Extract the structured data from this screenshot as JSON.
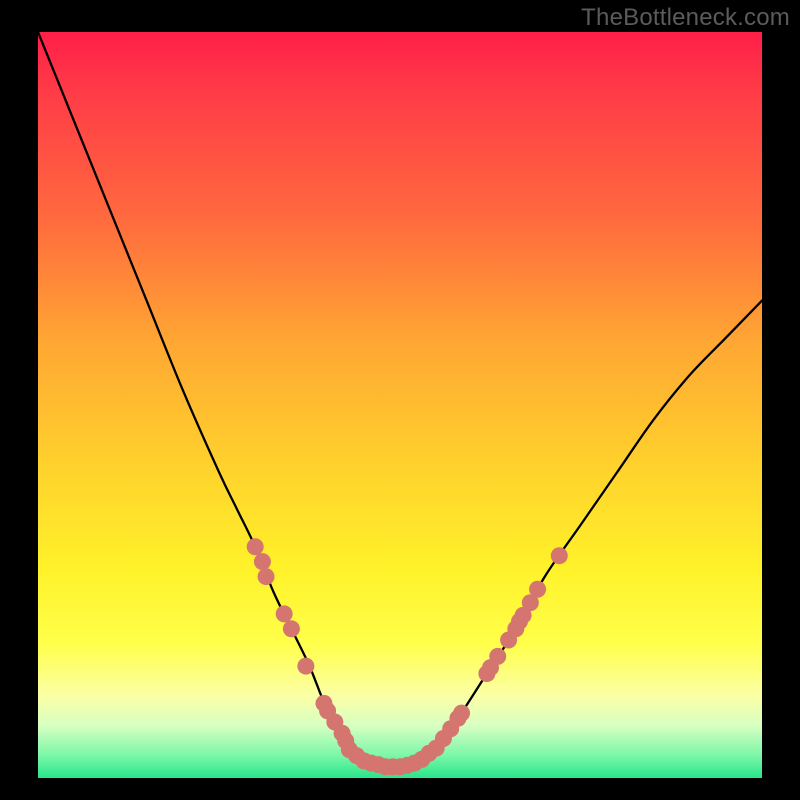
{
  "attribution": "TheBottleneck.com",
  "colors": {
    "frame": "#000000",
    "curve": "#000000",
    "marker_fill": "#d4766f",
    "marker_stroke": "none"
  },
  "chart_data": {
    "type": "line",
    "title": "",
    "xlabel": "",
    "ylabel": "",
    "xlim": [
      0,
      100
    ],
    "ylim": [
      0,
      100
    ],
    "grid": false,
    "legend": false,
    "series": [
      {
        "name": "bottleneck-curve",
        "x": [
          0,
          5,
          10,
          15,
          20,
          25,
          27.5,
          30,
          32.5,
          35,
          37.5,
          40,
          42.5,
          44,
          46,
          48,
          50,
          52,
          55,
          58,
          62,
          66,
          70,
          75,
          80,
          85,
          90,
          95,
          100
        ],
        "y": [
          100,
          88,
          76,
          64,
          52,
          41,
          36,
          31,
          25,
          20,
          15,
          9,
          5,
          3,
          2,
          1.5,
          1.5,
          2,
          4,
          8,
          14,
          20,
          27,
          34,
          41,
          48,
          54,
          59,
          64
        ]
      }
    ],
    "markers": [
      {
        "name": "highlight-points",
        "points": [
          {
            "x": 30.0,
            "y": 31
          },
          {
            "x": 31.0,
            "y": 29
          },
          {
            "x": 31.5,
            "y": 27
          },
          {
            "x": 34.0,
            "y": 22
          },
          {
            "x": 35.0,
            "y": 20
          },
          {
            "x": 37.0,
            "y": 15
          },
          {
            "x": 39.5,
            "y": 10
          },
          {
            "x": 40.0,
            "y": 9
          },
          {
            "x": 41.0,
            "y": 7.5
          },
          {
            "x": 42.0,
            "y": 6
          },
          {
            "x": 42.5,
            "y": 5
          },
          {
            "x": 43.0,
            "y": 3.8
          },
          {
            "x": 44.0,
            "y": 3
          },
          {
            "x": 45.0,
            "y": 2.3
          },
          {
            "x": 46.0,
            "y": 2
          },
          {
            "x": 47.0,
            "y": 1.8
          },
          {
            "x": 48.0,
            "y": 1.5
          },
          {
            "x": 49.0,
            "y": 1.5
          },
          {
            "x": 50.0,
            "y": 1.5
          },
          {
            "x": 51.0,
            "y": 1.7
          },
          {
            "x": 52.0,
            "y": 2
          },
          {
            "x": 53.0,
            "y": 2.5
          },
          {
            "x": 54.0,
            "y": 3.3
          },
          {
            "x": 55.0,
            "y": 4
          },
          {
            "x": 56.0,
            "y": 5.3
          },
          {
            "x": 57.0,
            "y": 6.6
          },
          {
            "x": 58.0,
            "y": 8
          },
          {
            "x": 58.5,
            "y": 8.7
          },
          {
            "x": 62.0,
            "y": 14
          },
          {
            "x": 62.5,
            "y": 14.8
          },
          {
            "x": 63.5,
            "y": 16.3
          },
          {
            "x": 65.0,
            "y": 18.5
          },
          {
            "x": 66.0,
            "y": 20
          },
          {
            "x": 66.5,
            "y": 21
          },
          {
            "x": 67.0,
            "y": 21.8
          },
          {
            "x": 68.0,
            "y": 23.5
          },
          {
            "x": 69.0,
            "y": 25.3
          },
          {
            "x": 72.0,
            "y": 29.8
          }
        ]
      }
    ]
  }
}
